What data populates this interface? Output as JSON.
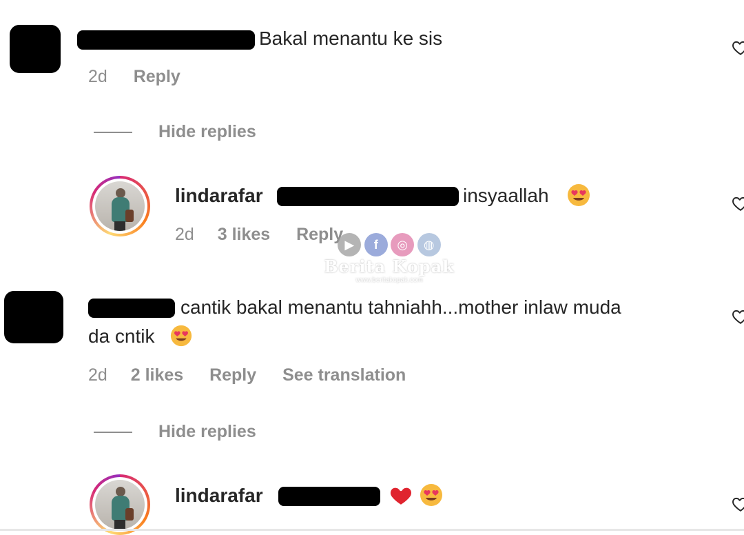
{
  "comments": [
    {
      "text": "Bakal menantu ke sis",
      "time": "2d",
      "reply_label": "Reply",
      "hide_replies_label": "Hide replies",
      "reply": {
        "username": "lindarafar",
        "text": "insyaallah",
        "time": "2d",
        "likes": "3 likes",
        "reply_label": "Reply"
      }
    },
    {
      "text_line1": "cantik bakal menantu tahniahh...mother inlaw muda",
      "text_line2": "da cntik",
      "time": "2d",
      "likes": "2 likes",
      "reply_label": "Reply",
      "translation_label": "See translation",
      "hide_replies_label": "Hide replies",
      "reply": {
        "username": "lindarafar"
      }
    }
  ],
  "watermark": {
    "name": "Berita Kopak",
    "url": "www.beritakopak.com"
  },
  "icons": {
    "heart": "heart-outline-icon",
    "emoji": "heart-eyes-emoji",
    "red_heart": "red-heart-emoji"
  },
  "colors": {
    "text": "#262626",
    "meta": "#8e8e8e",
    "story_ring": "#d62976"
  }
}
